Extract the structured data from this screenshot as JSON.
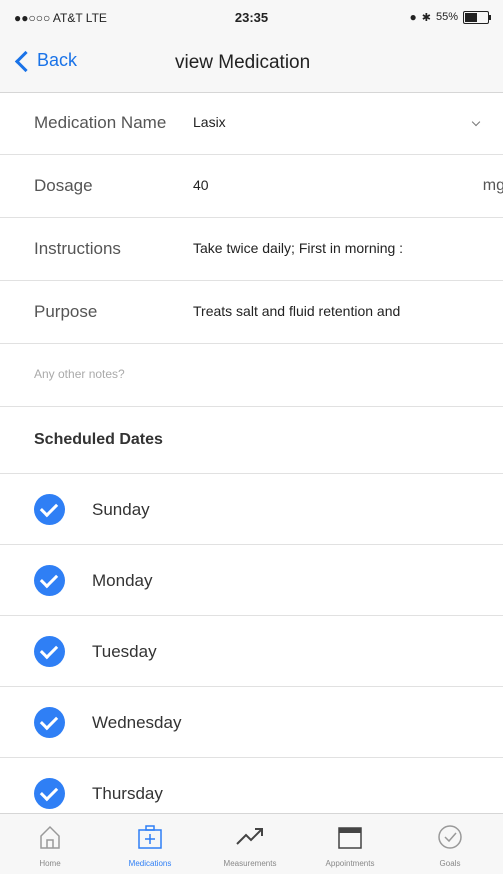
{
  "status_bar": {
    "carrier": "●●○○○ AT&T  LTE",
    "time": "23:35",
    "battery": "55%",
    "battery_level": 0.55
  },
  "nav": {
    "back_label": "Back",
    "title": "view Medication"
  },
  "form": {
    "medication_name": {
      "label": "Medication Name",
      "value": "Lasix"
    },
    "dosage": {
      "label": "Dosage",
      "value": "40",
      "unit": "mg"
    },
    "instructions": {
      "label": "Instructions",
      "value": "Take twice daily; First in morning :"
    },
    "purpose": {
      "label": "Purpose",
      "value": "Treats salt and fluid retention and"
    },
    "notes": {
      "placeholder": "Any other notes?"
    }
  },
  "schedule": {
    "heading": "Scheduled Dates",
    "days": [
      {
        "name": "Sunday",
        "checked": true
      },
      {
        "name": "Monday",
        "checked": true
      },
      {
        "name": "Tuesday",
        "checked": true
      },
      {
        "name": "Wednesday",
        "checked": true
      },
      {
        "name": "Thursday",
        "checked": true
      }
    ]
  },
  "tabs": [
    {
      "label": "Home",
      "icon": "home-icon",
      "active": false
    },
    {
      "label": "Medications",
      "icon": "medkit-icon",
      "active": true
    },
    {
      "label": "Measurements",
      "icon": "trend-icon",
      "active": false
    },
    {
      "label": "Appointments",
      "icon": "calendar-icon",
      "active": false
    },
    {
      "label": "Goals",
      "icon": "check-circle-icon",
      "active": false
    }
  ],
  "colors": {
    "accent": "#2f7ff5",
    "link": "#1a73e8"
  }
}
